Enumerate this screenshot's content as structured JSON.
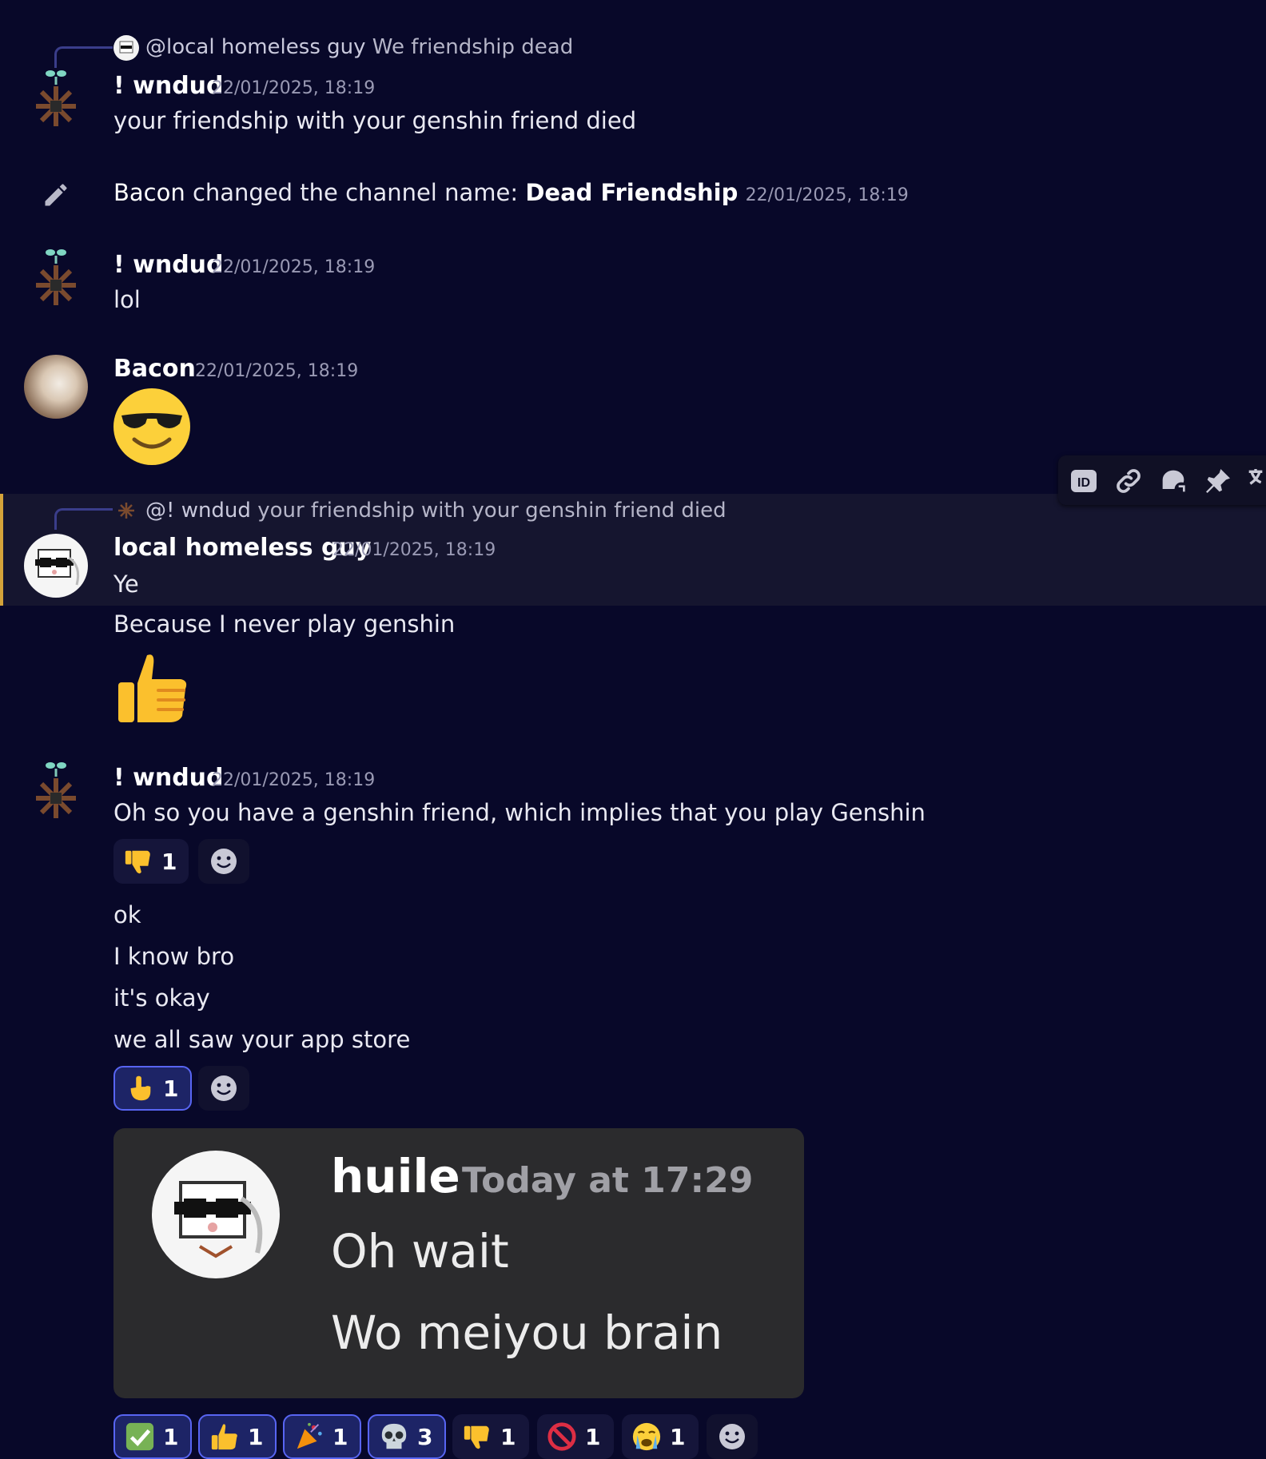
{
  "colors": {
    "background": "#080829",
    "hover_row": "#15152f",
    "hover_accent": "#d4a33a",
    "reaction_selected_border": "#5865f2",
    "embed_background": "#2b2b2d"
  },
  "messages": {
    "m1": {
      "reply_to_user": "@local homeless guy",
      "reply_text": "We friendship dead",
      "author": "! wndud",
      "timestamp": "22/01/2025, 18:19",
      "text": "your friendship with your genshin friend died"
    },
    "system": {
      "actor": "Bacon",
      "action": "changed the channel name:",
      "new_name": "Dead Friendship",
      "timestamp": "22/01/2025, 18:19",
      "icon": "pencil-icon"
    },
    "m2": {
      "author": "! wndud",
      "timestamp": "22/01/2025, 18:19",
      "text": "lol"
    },
    "m3": {
      "author": "Bacon",
      "timestamp": "22/01/2025, 18:19",
      "emoji": "sunglasses-face-emoji"
    },
    "m4": {
      "reply_to_user": "@! wndud",
      "reply_text": "your friendship with your genshin friend died",
      "author": "local homeless guy",
      "timestamp": "22/01/2025, 18:19",
      "lines": [
        "Ye",
        "Because I never play genshin"
      ],
      "emoji": "thumbs-up-emoji"
    },
    "m5": {
      "author": "! wndud",
      "timestamp": "22/01/2025, 18:19",
      "text": "Oh so you have a genshin friend, which implies that you play Genshin",
      "reactions": [
        {
          "emoji": "thumbs-down",
          "count": "1"
        }
      ],
      "lines": [
        "ok",
        "I know bro",
        "it's okay",
        "we all saw your app store"
      ],
      "reactions2": [
        {
          "emoji": "point-up",
          "count": "1",
          "selected": true
        }
      ],
      "embed": {
        "author": "huile",
        "timestamp": "Today at 17:29",
        "lines": [
          "Oh wait",
          "Wo meiyou brain"
        ]
      },
      "reactions3": [
        {
          "emoji": "check-mark",
          "count": "1",
          "selected": true
        },
        {
          "emoji": "thumbs-up",
          "count": "1",
          "selected": true
        },
        {
          "emoji": "party-popper",
          "count": "1",
          "selected": true
        },
        {
          "emoji": "skull",
          "count": "3",
          "selected": true
        },
        {
          "emoji": "thumbs-down",
          "count": "1",
          "selected": false
        },
        {
          "emoji": "prohibited",
          "count": "1",
          "selected": false
        },
        {
          "emoji": "crying-face",
          "count": "1",
          "selected": false
        }
      ]
    }
  },
  "toolbar": {
    "icons": [
      "id-icon",
      "link-icon",
      "thread-icon",
      "pin-icon",
      "translate-icon"
    ]
  }
}
